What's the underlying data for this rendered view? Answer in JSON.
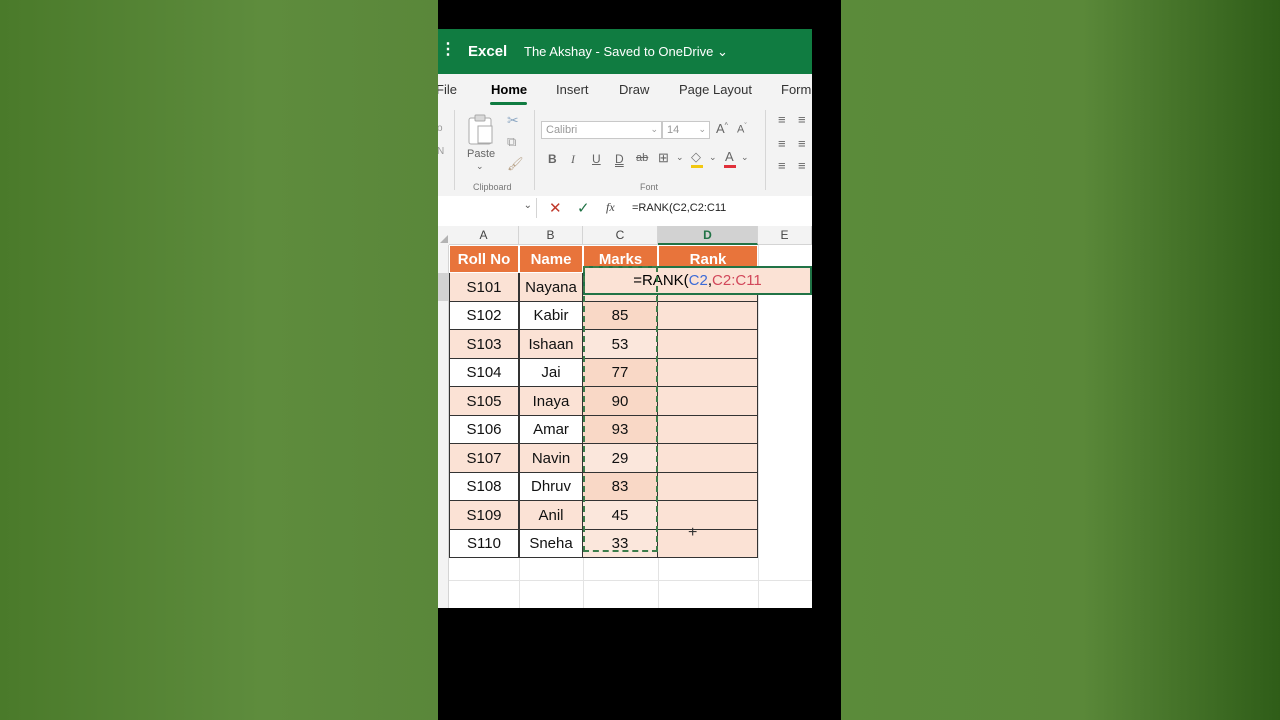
{
  "titlebar": {
    "app_name": "Excel",
    "document": "The Akshay  -  Saved to OneDrive",
    "dropdown_glyph": "⌄"
  },
  "tabs": [
    {
      "label": "File"
    },
    {
      "label": "Home",
      "active": true
    },
    {
      "label": "Insert"
    },
    {
      "label": "Draw"
    },
    {
      "label": "Page Layout"
    },
    {
      "label": "Form"
    }
  ],
  "ribbon": {
    "paste_label": "Paste",
    "clipboard_label": "Clipboard",
    "font_label": "Font",
    "font_name": "Calibri",
    "font_size": "14",
    "cut_label": "o",
    "copy_label": "N"
  },
  "formula_bar": {
    "cancel_icon": "✕",
    "enter_icon": "✓",
    "fx_label": "fx",
    "formula": "=RANK(C2,C2:C11"
  },
  "grid": {
    "columns": [
      "A",
      "B",
      "C",
      "D",
      "E"
    ],
    "selected_column": "D",
    "headers": [
      "Roll No",
      "Name",
      "Marks",
      "Rank"
    ],
    "rows": [
      {
        "roll": "S101",
        "name": "Nayana",
        "marks": ""
      },
      {
        "roll": "S102",
        "name": "Kabir",
        "marks": "85"
      },
      {
        "roll": "S103",
        "name": "Ishaan",
        "marks": "53"
      },
      {
        "roll": "S104",
        "name": "Jai",
        "marks": "77"
      },
      {
        "roll": "S105",
        "name": "Inaya",
        "marks": "90"
      },
      {
        "roll": "S106",
        "name": "Amar",
        "marks": "93"
      },
      {
        "roll": "S107",
        "name": "Navin",
        "marks": "29"
      },
      {
        "roll": "S108",
        "name": "Dhruv",
        "marks": "83"
      },
      {
        "roll": "S109",
        "name": "Anil",
        "marks": "45"
      },
      {
        "roll": "S110",
        "name": "Sneha",
        "marks": "33"
      }
    ],
    "edit_cell": {
      "prefix": "=RANK(",
      "ref1": "C2",
      "comma": ",",
      "ref2": "C2:C11"
    }
  },
  "colors": {
    "excel_green": "#107c41",
    "header_orange": "#e8743b",
    "peach": "#fbe2d5"
  }
}
